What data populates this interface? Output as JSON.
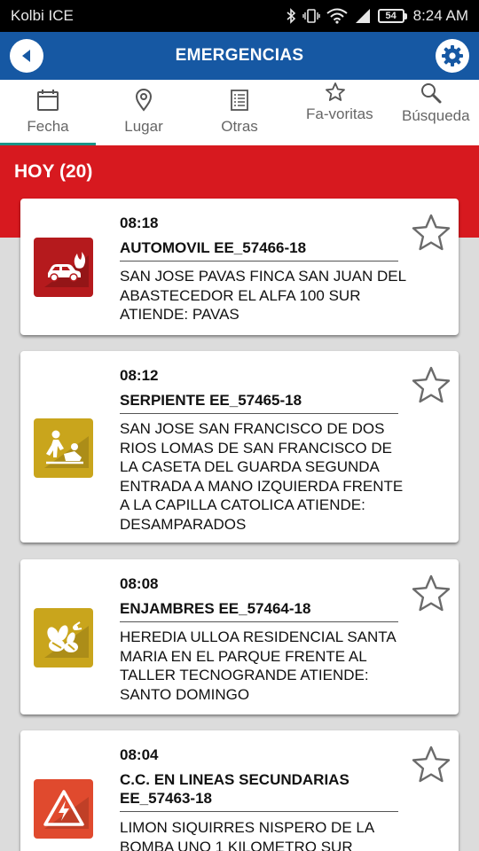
{
  "status_bar": {
    "carrier": "Kolbi ICE",
    "battery": "54",
    "time": "8:24 AM"
  },
  "app_bar": {
    "title": "EMERGENCIAS"
  },
  "tabs": [
    {
      "label": "Fecha",
      "icon": "calendar-icon",
      "active": true
    },
    {
      "label": "Lugar",
      "icon": "location-pin-icon",
      "active": false
    },
    {
      "label": "Otras",
      "icon": "list-document-icon",
      "active": false
    },
    {
      "label": "Fa-voritas",
      "icon": "star-outline-icon",
      "active": false
    },
    {
      "label": "Búsqueda",
      "icon": "search-icon",
      "active": false
    }
  ],
  "section": {
    "title": "HOY (20)"
  },
  "colors": {
    "app_bar": "#1658a3",
    "section_band": "#d7191f",
    "active_tab_indicator": "#1a9488"
  },
  "incidents": [
    {
      "time": "08:18",
      "title": "AUTOMOVIL EE_57466-18",
      "description": "SAN JOSE PAVAS FINCA SAN JUAN DEL ABASTECEDOR  EL ALFA 100 SUR ATIENDE: PAVAS",
      "icon": "car-fire-icon",
      "color": "#b51a1d"
    },
    {
      "time": "08:12",
      "title": "SERPIENTE EE_57465-18",
      "description": "SAN JOSE SAN FRANCISCO DE DOS RIOS LOMAS DE SAN FRANCISCO DE LA CASETA DEL GUARDA SEGUNDA ENTRADA A MANO IZQUIERDA FRENTE A LA CAPILLA CATOLICA ATIENDE: DESAMPARADOS",
      "icon": "rescue-person-icon",
      "color": "#c9a51c"
    },
    {
      "time": "08:08",
      "title": "ENJAMBRES EE_57464-18",
      "description": "HEREDIA ULLOA RESIDENCIAL SANTA MARIA EN EL PARQUE FRENTE AL TALLER TECNOGRANDE ATIENDE: SANTO DOMINGO",
      "icon": "bees-icon",
      "color": "#c9a51c"
    },
    {
      "time": "08:04",
      "title": "C.C. EN LINEAS SECUNDARIAS EE_57463-18",
      "description": "LIMON SIQUIRRES NISPERO DE LA BOMBA UNO 1 KILOMETRO SUR",
      "icon": "electric-hazard-icon",
      "color": "#e04a2e"
    }
  ]
}
